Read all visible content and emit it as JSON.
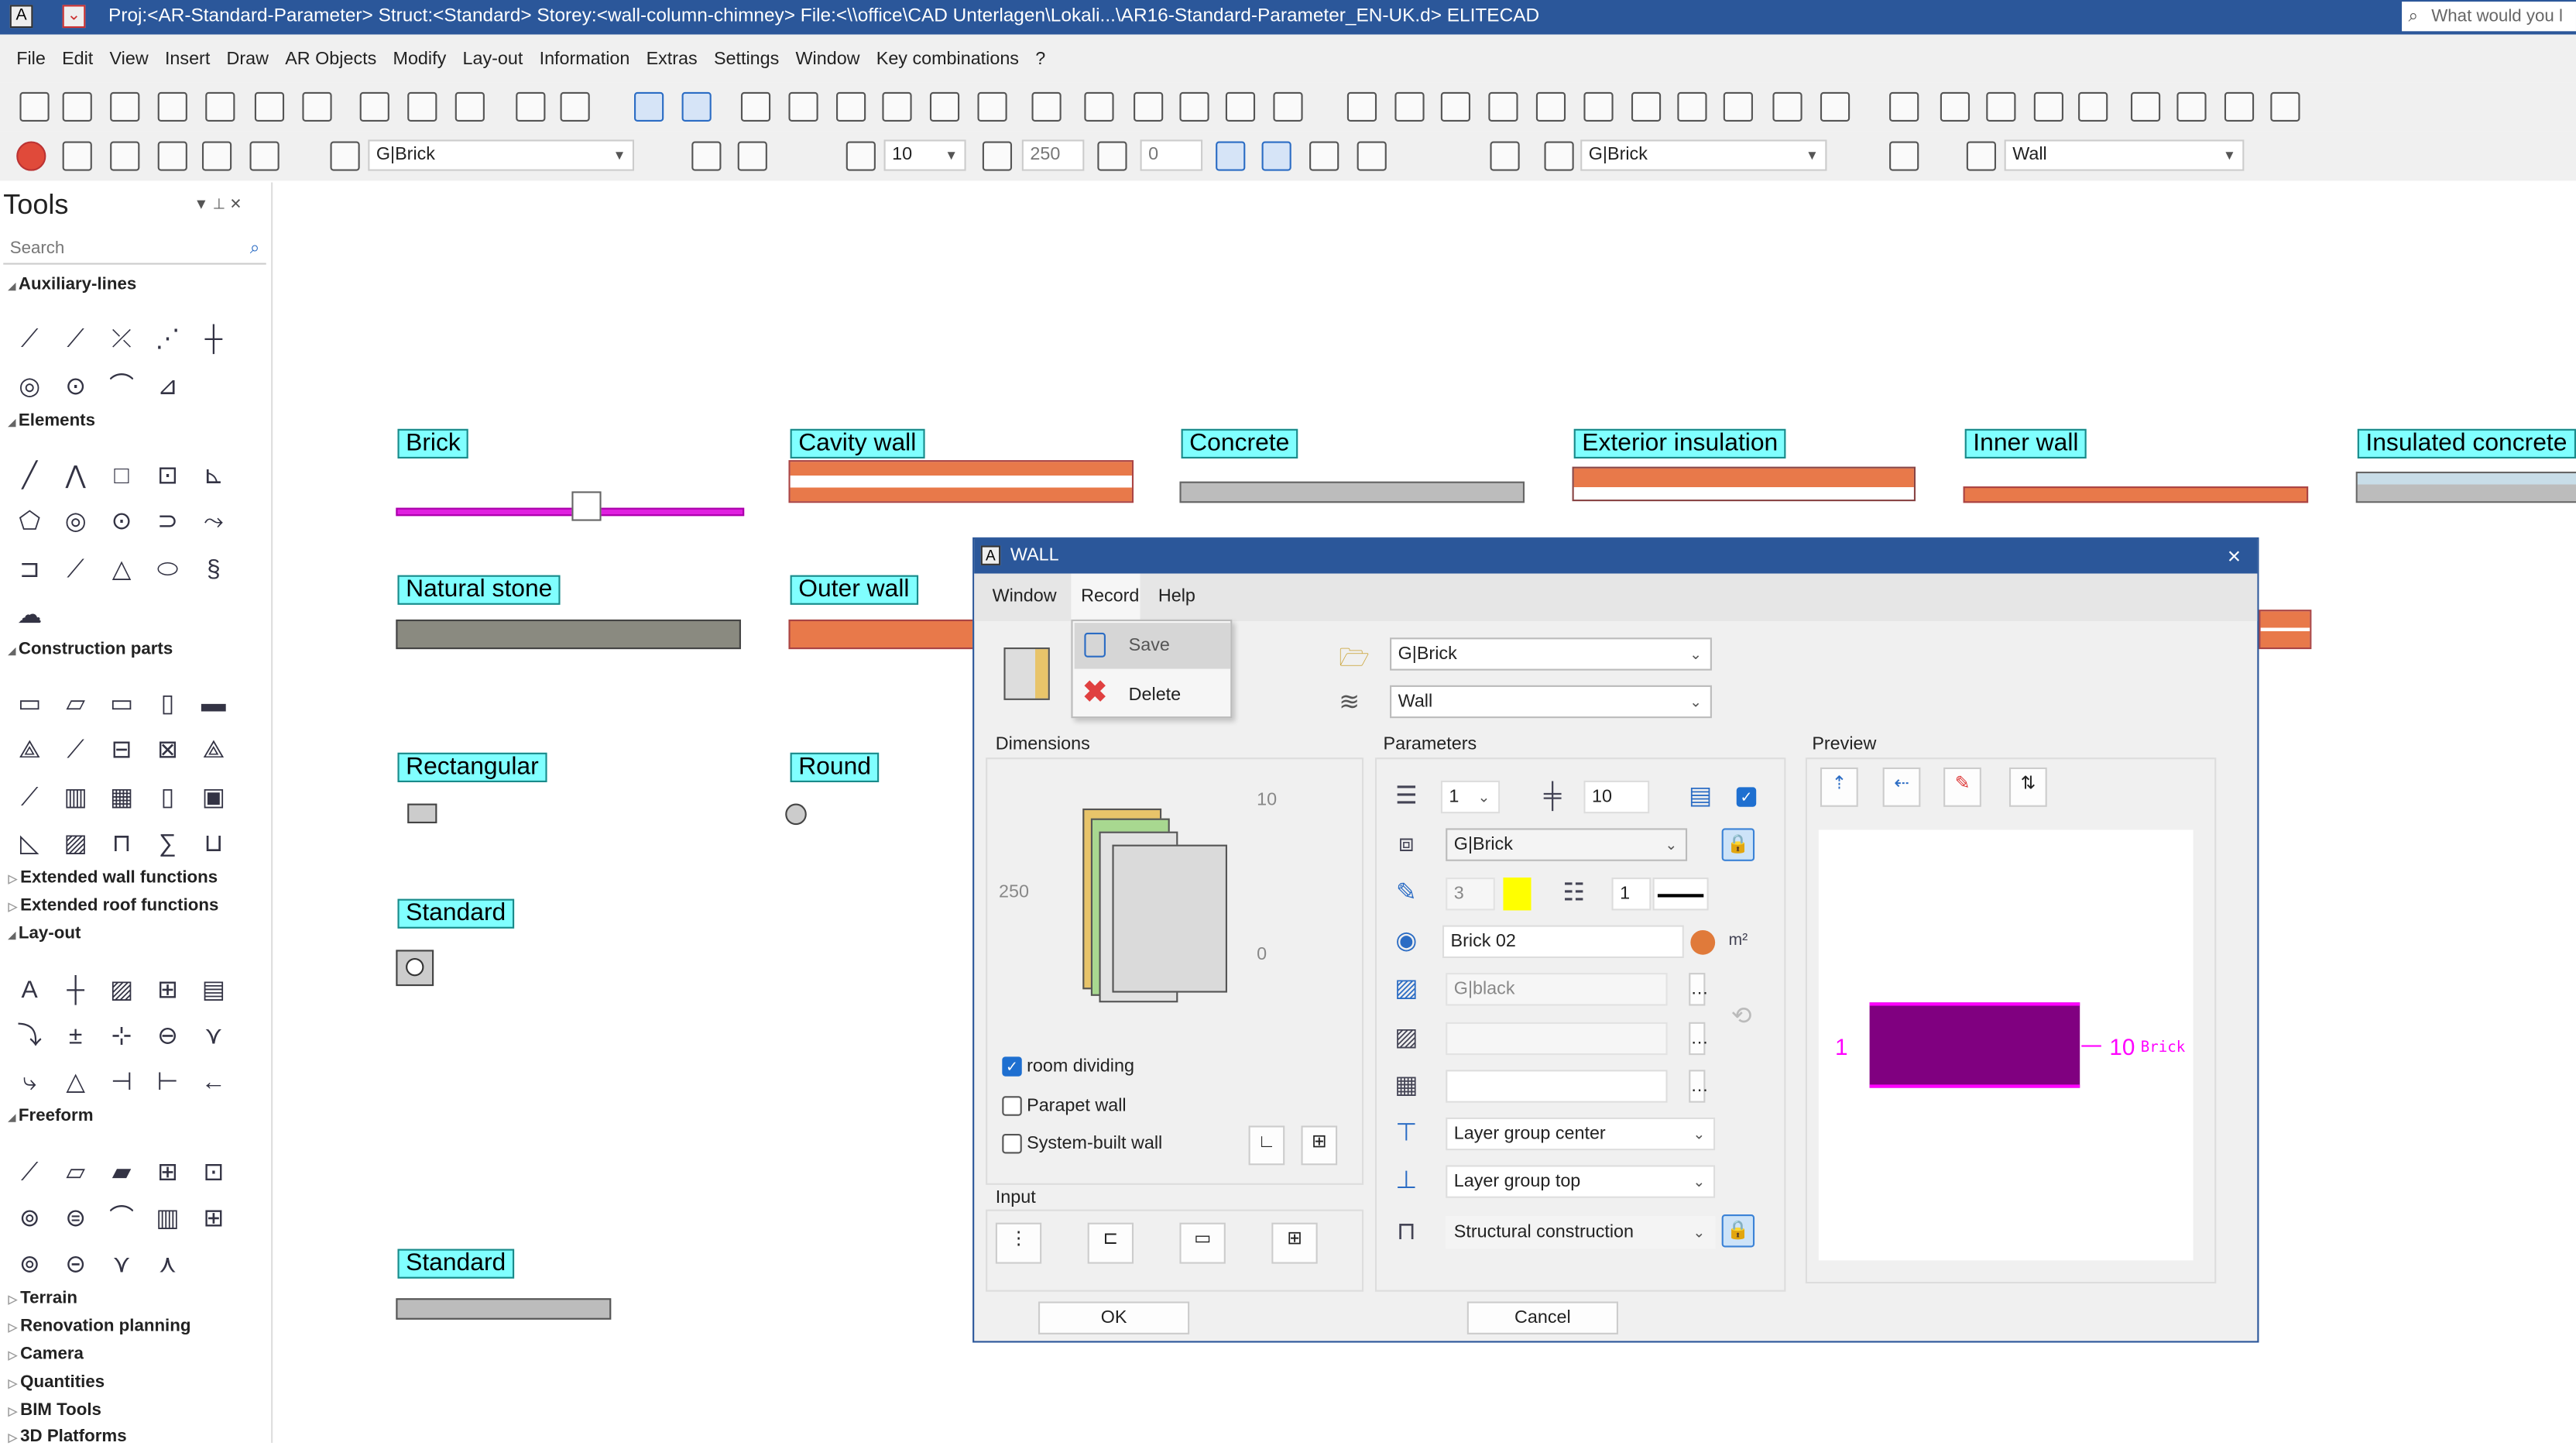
{
  "titlebar": {
    "app_icon": "elitecad-icon",
    "title": "Proj:<AR-Standard-Parameter> Struct:<Standard>  Storey:<wall-column-chimney>  File:<\\\\office\\CAD Unterlagen\\Lokali...\\AR16-Standard-Parameter_EN-UK.d>  ELITECAD",
    "search_placeholder": "What would you l"
  },
  "menu": [
    "File",
    "Edit",
    "View",
    "Insert",
    "Draw",
    "AR Objects",
    "Modify",
    "Lay-out",
    "Information",
    "Extras",
    "Settings",
    "Window",
    "Key combinations",
    "?"
  ],
  "toolbar": {
    "material_combo": "G|Brick",
    "thickness": "10",
    "height": "250",
    "offset": "0",
    "material_combo2": "G|Brick",
    "layer_combo": "Wall"
  },
  "tools": {
    "title": "Tools",
    "search_placeholder": "Search",
    "sections": [
      "Auxiliary-lines",
      "Elements",
      "Construction parts",
      "Extended wall functions",
      "Extended roof functions",
      "Lay-out",
      "Freeform",
      "Terrain",
      "Renovation planning",
      "Camera",
      "Quantities",
      "BIM Tools",
      "3D Platforms"
    ]
  },
  "canvas": {
    "labels": [
      "Brick",
      "Cavity wall",
      "Concrete",
      "Exterior insulation",
      "Inner wall",
      "Insulated concrete",
      "Natural stone",
      "Outer wall",
      "Rectangular",
      "Round",
      "Standard",
      "Standard"
    ]
  },
  "dialog": {
    "title": "WALL",
    "close": "×",
    "menu": [
      "Window",
      "Record",
      "Help"
    ],
    "record_menu": {
      "save": "Save",
      "delete": "Delete"
    },
    "material": "G|Brick",
    "layer": "Wall",
    "dimensions": {
      "title": "Dimensions",
      "thickness": "10",
      "height": "250",
      "offset": "0",
      "room_dividing": {
        "label": "room dividing",
        "checked": true
      },
      "parapet_wall": {
        "label": "Parapet wall",
        "checked": false
      },
      "system_built_wall": {
        "label": "System-built wall",
        "checked": false
      }
    },
    "input": {
      "title": "Input"
    },
    "parameters": {
      "title": "Parameters",
      "layer_count": "1",
      "layer_thickness": "10",
      "hatch_checked": true,
      "material": "G|Brick",
      "pen": "3",
      "pen_color": "#ffff00",
      "line_type": "1",
      "surface": "Brick 02",
      "hatch": "G|black",
      "reference": "Layer group center",
      "position": "Layer group top",
      "function": "Structural construction"
    },
    "preview": {
      "title": "Preview",
      "left_label": "1",
      "right_value": "10",
      "right_name": "Brick",
      "fill": "#800080",
      "accent": "#ff00ff"
    },
    "ok": "OK",
    "cancel": "Cancel"
  }
}
